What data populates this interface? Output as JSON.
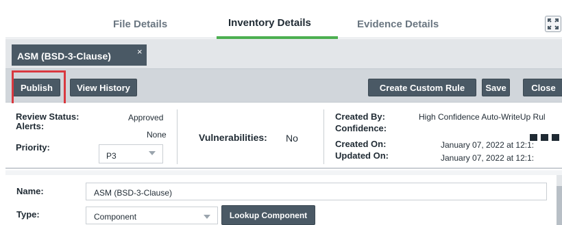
{
  "tabs": {
    "file_details": "File Details",
    "inventory_details": "Inventory Details",
    "evidence_details": "Evidence Details",
    "active": "inventory_details"
  },
  "component_tab": {
    "label": "ASM (BSD-3-Clause)",
    "close": "×"
  },
  "toolbar": {
    "publish": "Publish",
    "view_history": "View History",
    "create_custom_rule": "Create Custom Rule",
    "save": "Save",
    "close": "Close"
  },
  "info": {
    "review_status_label": "Review Status:",
    "review_status_value": "Approved",
    "alerts_label": "Alerts:",
    "alerts_value": "None",
    "priority_label": "Priority:",
    "priority_value": "P3",
    "vulnerabilities_label": "Vulnerabilities:",
    "vulnerabilities_value": "No",
    "created_by_label": "Created By:",
    "created_by_value": "High Confidence Auto-WriteUp Rul",
    "confidence_label": "Confidence:",
    "confidence_level": 3,
    "created_on_label": "Created On:",
    "created_on_value": "January 07, 2022 at 12:1:",
    "updated_on_label": "Updated On:",
    "updated_on_value": "January 07, 2022 at 12:1:"
  },
  "form": {
    "name_label": "Name:",
    "name_value": "ASM (BSD-3-Clause)",
    "type_label": "Type:",
    "type_value": "Component",
    "lookup_component": "Lookup Component"
  },
  "colors": {
    "active_tab_underline": "#4caf50",
    "button_bg": "#4a5965",
    "highlight_border": "#d9383f"
  }
}
